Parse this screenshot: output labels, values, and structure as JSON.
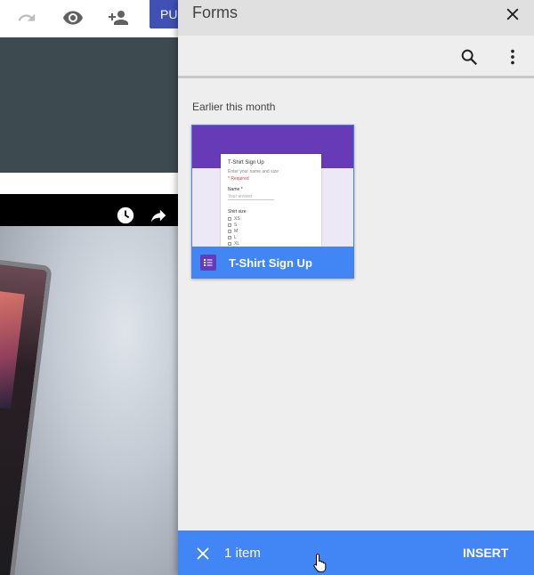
{
  "editor": {
    "toolbar": {
      "redo_icon": "redo-icon",
      "preview_icon": "eye-icon",
      "share_icon": "add-person-icon",
      "publish_label": "PU"
    },
    "video": {
      "watch_later_icon": "clock-icon",
      "share_icon": "share-arrow-icon"
    }
  },
  "panel": {
    "title": "Forms",
    "close_icon": "close-icon",
    "toolbar": {
      "search_icon": "search-icon",
      "menu_icon": "more-vert-icon"
    },
    "section_label": "Earlier this month",
    "items": [
      {
        "name": "T-Shirt Sign Up",
        "type_icon": "google-forms-icon",
        "thumbnail": {
          "header_color": "#673ab7",
          "title": "T-Shirt Sign Up",
          "description": "Enter your name and size",
          "required_note": "* Required",
          "question_1": "Name *",
          "answer_placeholder": "Your answer",
          "question_2": "Shirt size",
          "options": [
            "XS",
            "S",
            "M",
            "L",
            "XL"
          ]
        }
      }
    ],
    "action_bar": {
      "deselect_icon": "close-icon",
      "count_label": "1 item",
      "insert_label": "INSERT"
    }
  },
  "colors": {
    "accent_blue": "#4285f4",
    "publish_indigo": "#3f51b5",
    "forms_purple": "#673ab7"
  }
}
